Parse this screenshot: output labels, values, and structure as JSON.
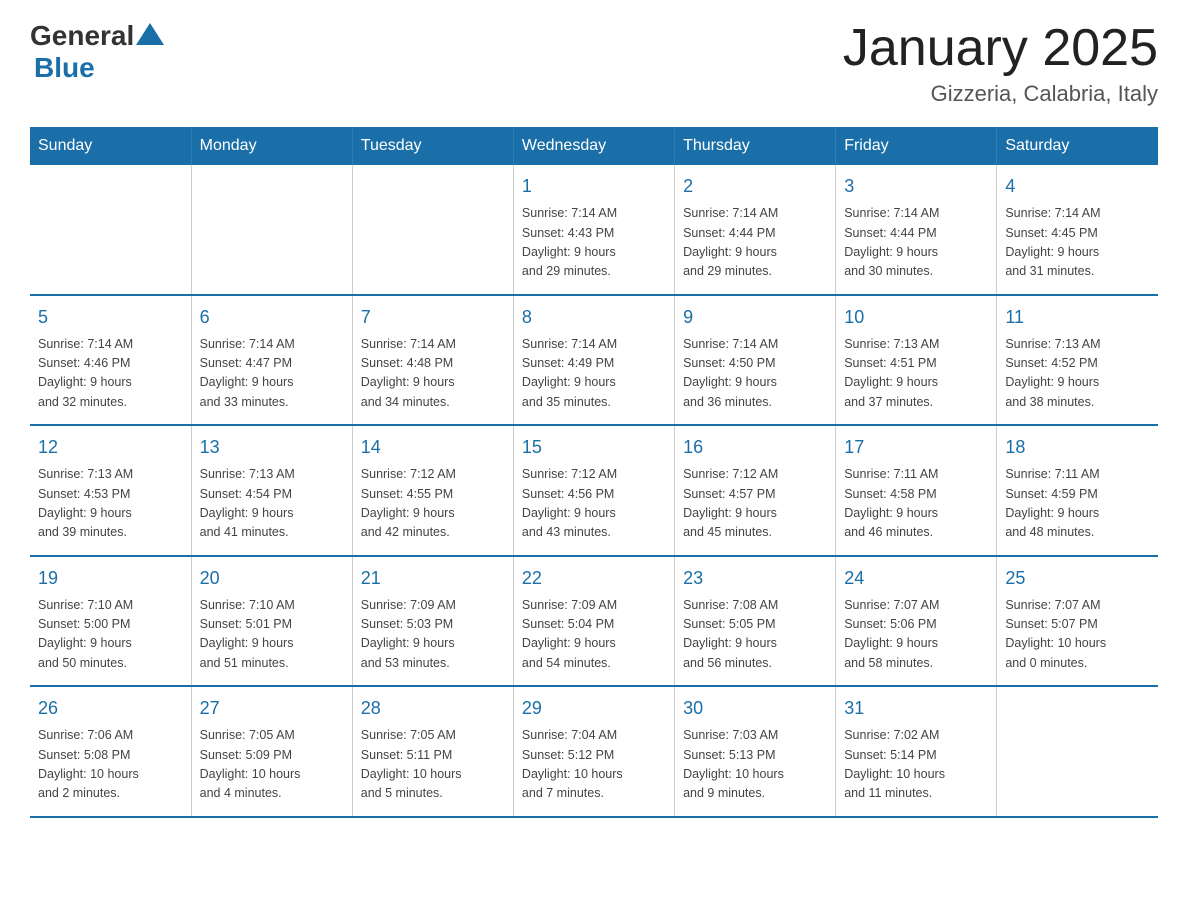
{
  "header": {
    "logo_general": "General",
    "logo_blue": "Blue",
    "month_title": "January 2025",
    "location": "Gizzeria, Calabria, Italy"
  },
  "weekdays": [
    "Sunday",
    "Monday",
    "Tuesday",
    "Wednesday",
    "Thursday",
    "Friday",
    "Saturday"
  ],
  "weeks": [
    [
      {
        "day": "",
        "info": ""
      },
      {
        "day": "",
        "info": ""
      },
      {
        "day": "",
        "info": ""
      },
      {
        "day": "1",
        "info": "Sunrise: 7:14 AM\nSunset: 4:43 PM\nDaylight: 9 hours\nand 29 minutes."
      },
      {
        "day": "2",
        "info": "Sunrise: 7:14 AM\nSunset: 4:44 PM\nDaylight: 9 hours\nand 29 minutes."
      },
      {
        "day": "3",
        "info": "Sunrise: 7:14 AM\nSunset: 4:44 PM\nDaylight: 9 hours\nand 30 minutes."
      },
      {
        "day": "4",
        "info": "Sunrise: 7:14 AM\nSunset: 4:45 PM\nDaylight: 9 hours\nand 31 minutes."
      }
    ],
    [
      {
        "day": "5",
        "info": "Sunrise: 7:14 AM\nSunset: 4:46 PM\nDaylight: 9 hours\nand 32 minutes."
      },
      {
        "day": "6",
        "info": "Sunrise: 7:14 AM\nSunset: 4:47 PM\nDaylight: 9 hours\nand 33 minutes."
      },
      {
        "day": "7",
        "info": "Sunrise: 7:14 AM\nSunset: 4:48 PM\nDaylight: 9 hours\nand 34 minutes."
      },
      {
        "day": "8",
        "info": "Sunrise: 7:14 AM\nSunset: 4:49 PM\nDaylight: 9 hours\nand 35 minutes."
      },
      {
        "day": "9",
        "info": "Sunrise: 7:14 AM\nSunset: 4:50 PM\nDaylight: 9 hours\nand 36 minutes."
      },
      {
        "day": "10",
        "info": "Sunrise: 7:13 AM\nSunset: 4:51 PM\nDaylight: 9 hours\nand 37 minutes."
      },
      {
        "day": "11",
        "info": "Sunrise: 7:13 AM\nSunset: 4:52 PM\nDaylight: 9 hours\nand 38 minutes."
      }
    ],
    [
      {
        "day": "12",
        "info": "Sunrise: 7:13 AM\nSunset: 4:53 PM\nDaylight: 9 hours\nand 39 minutes."
      },
      {
        "day": "13",
        "info": "Sunrise: 7:13 AM\nSunset: 4:54 PM\nDaylight: 9 hours\nand 41 minutes."
      },
      {
        "day": "14",
        "info": "Sunrise: 7:12 AM\nSunset: 4:55 PM\nDaylight: 9 hours\nand 42 minutes."
      },
      {
        "day": "15",
        "info": "Sunrise: 7:12 AM\nSunset: 4:56 PM\nDaylight: 9 hours\nand 43 minutes."
      },
      {
        "day": "16",
        "info": "Sunrise: 7:12 AM\nSunset: 4:57 PM\nDaylight: 9 hours\nand 45 minutes."
      },
      {
        "day": "17",
        "info": "Sunrise: 7:11 AM\nSunset: 4:58 PM\nDaylight: 9 hours\nand 46 minutes."
      },
      {
        "day": "18",
        "info": "Sunrise: 7:11 AM\nSunset: 4:59 PM\nDaylight: 9 hours\nand 48 minutes."
      }
    ],
    [
      {
        "day": "19",
        "info": "Sunrise: 7:10 AM\nSunset: 5:00 PM\nDaylight: 9 hours\nand 50 minutes."
      },
      {
        "day": "20",
        "info": "Sunrise: 7:10 AM\nSunset: 5:01 PM\nDaylight: 9 hours\nand 51 minutes."
      },
      {
        "day": "21",
        "info": "Sunrise: 7:09 AM\nSunset: 5:03 PM\nDaylight: 9 hours\nand 53 minutes."
      },
      {
        "day": "22",
        "info": "Sunrise: 7:09 AM\nSunset: 5:04 PM\nDaylight: 9 hours\nand 54 minutes."
      },
      {
        "day": "23",
        "info": "Sunrise: 7:08 AM\nSunset: 5:05 PM\nDaylight: 9 hours\nand 56 minutes."
      },
      {
        "day": "24",
        "info": "Sunrise: 7:07 AM\nSunset: 5:06 PM\nDaylight: 9 hours\nand 58 minutes."
      },
      {
        "day": "25",
        "info": "Sunrise: 7:07 AM\nSunset: 5:07 PM\nDaylight: 10 hours\nand 0 minutes."
      }
    ],
    [
      {
        "day": "26",
        "info": "Sunrise: 7:06 AM\nSunset: 5:08 PM\nDaylight: 10 hours\nand 2 minutes."
      },
      {
        "day": "27",
        "info": "Sunrise: 7:05 AM\nSunset: 5:09 PM\nDaylight: 10 hours\nand 4 minutes."
      },
      {
        "day": "28",
        "info": "Sunrise: 7:05 AM\nSunset: 5:11 PM\nDaylight: 10 hours\nand 5 minutes."
      },
      {
        "day": "29",
        "info": "Sunrise: 7:04 AM\nSunset: 5:12 PM\nDaylight: 10 hours\nand 7 minutes."
      },
      {
        "day": "30",
        "info": "Sunrise: 7:03 AM\nSunset: 5:13 PM\nDaylight: 10 hours\nand 9 minutes."
      },
      {
        "day": "31",
        "info": "Sunrise: 7:02 AM\nSunset: 5:14 PM\nDaylight: 10 hours\nand 11 minutes."
      },
      {
        "day": "",
        "info": ""
      }
    ]
  ]
}
